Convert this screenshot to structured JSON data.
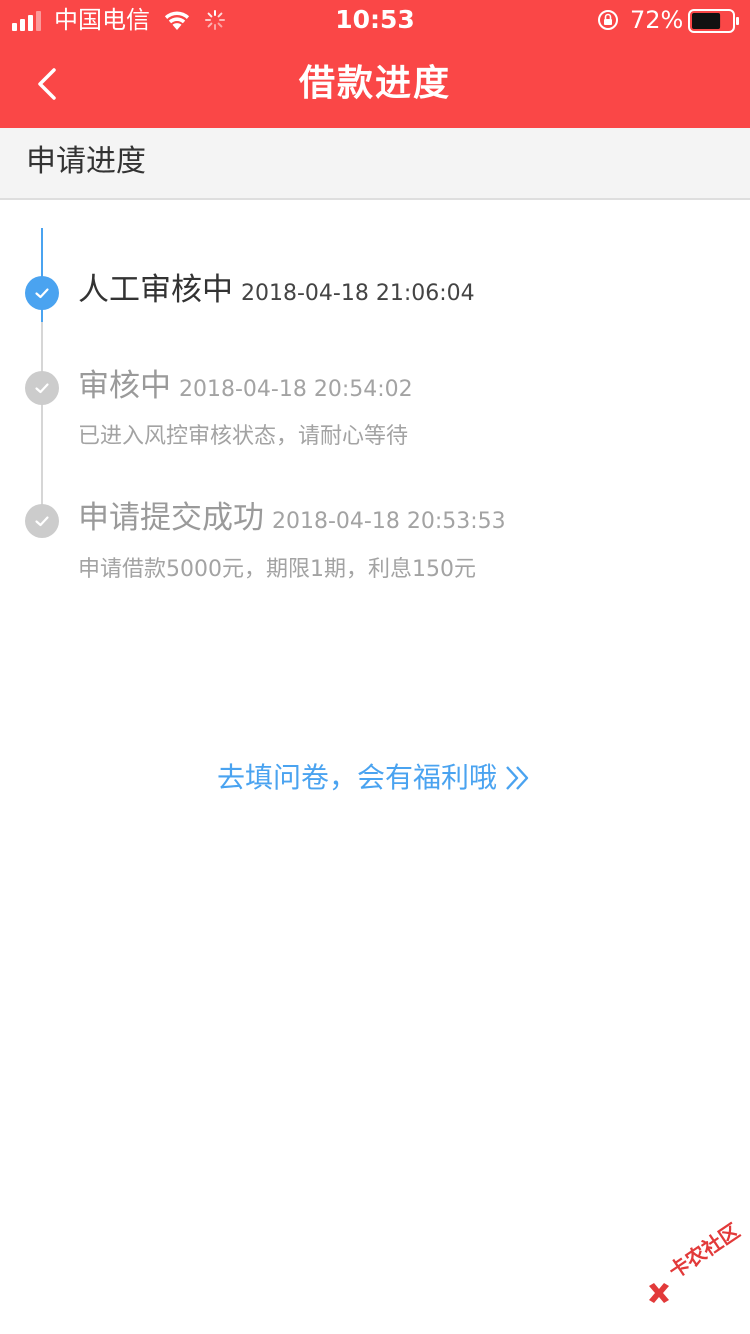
{
  "status_bar": {
    "carrier": "中国电信",
    "time": "10:53",
    "battery": "72%",
    "battery_level": 0.72,
    "icons": [
      "signal-icon",
      "wifi-icon",
      "activity-icon",
      "rotation-lock-icon",
      "battery-icon"
    ]
  },
  "nav": {
    "title": "借款进度",
    "back_icon": "chevron-left-icon"
  },
  "section": {
    "title": "申请进度"
  },
  "steps": [
    {
      "title": "人工审核中",
      "time": "2018-04-18 21:06:04",
      "desc": "",
      "state": "active"
    },
    {
      "title": "审核中",
      "time": "2018-04-18 20:54:02",
      "desc": "已进入风控审核状态，请耐心等待",
      "state": "done"
    },
    {
      "title": "申请提交成功",
      "time": "2018-04-18 20:53:53",
      "desc": "申请借款5000元，期限1期，利息150元",
      "state": "done"
    }
  ],
  "survey": {
    "label": "去填问卷，会有福利哦",
    "icon": "double-chevron-right-icon"
  },
  "watermark": {
    "text": "卡农社区"
  },
  "colors": {
    "header_bg": "#fa4747",
    "accent_blue": "#4aa3f0",
    "done_grey": "#cccccc",
    "section_bg": "#f4f4f4"
  }
}
